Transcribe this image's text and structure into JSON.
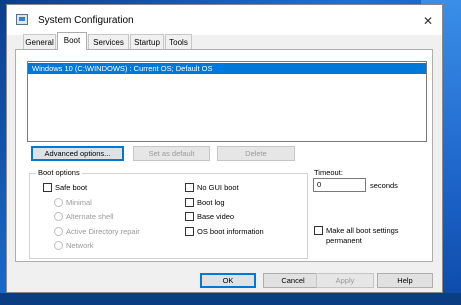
{
  "window": {
    "title": "System Configuration",
    "close_glyph": "✕"
  },
  "tabs": [
    "General",
    "Boot",
    "Services",
    "Startup",
    "Tools"
  ],
  "active_tab": "Boot",
  "os_list": {
    "items": [
      "Windows 10 (C:\\WINDOWS) : Current OS; Default OS"
    ]
  },
  "actions": {
    "advanced": "Advanced options...",
    "set_default": "Set as default",
    "delete": "Delete"
  },
  "boot_options": {
    "group_label": "Boot options",
    "safe_boot": "Safe boot",
    "minimal": "Minimal",
    "alternate_shell": "Alternate shell",
    "ad_repair": "Active Directory repair",
    "network": "Network",
    "no_gui_boot": "No GUI boot",
    "boot_log": "Boot log",
    "base_video": "Base video",
    "os_boot_info": "OS boot information"
  },
  "timeout": {
    "label": "Timeout:",
    "value": "0",
    "unit": "seconds"
  },
  "permanent": {
    "line1": "Make all boot settings",
    "line2": "permanent"
  },
  "footer": {
    "ok": "OK",
    "cancel": "Cancel",
    "apply": "Apply",
    "help": "Help"
  },
  "colors": {
    "selection": "#0078d7",
    "window_bg": "#f0f0f0",
    "desktop": "#1c6fd6"
  }
}
